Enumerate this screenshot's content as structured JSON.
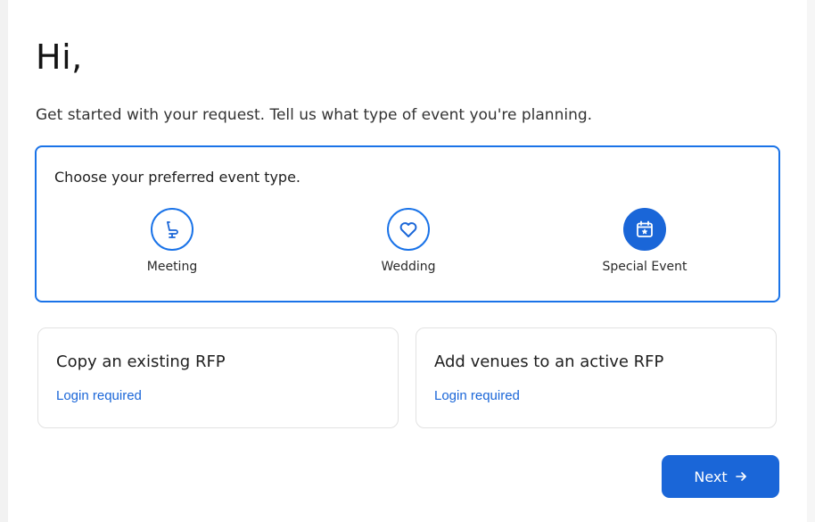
{
  "greeting": "Hi,",
  "intro": "Get started with your request. Tell us what type of event you're planning.",
  "event_type": {
    "prompt": "Choose your preferred event type.",
    "options": [
      {
        "label": "Meeting",
        "icon": "chair-icon",
        "selected": false
      },
      {
        "label": "Wedding",
        "icon": "heart-icon",
        "selected": false
      },
      {
        "label": "Special Event",
        "icon": "calendar-star-icon",
        "selected": true
      }
    ]
  },
  "cards": [
    {
      "title": "Copy an existing RFP",
      "link": "Login required"
    },
    {
      "title": "Add venues to an active RFP",
      "link": "Login required"
    }
  ],
  "next_button": {
    "label": "Next",
    "icon": "arrow-right-icon"
  },
  "colors": {
    "accent": "#1a66d8",
    "border": "#1a73e8",
    "card_border": "#e2e2e2"
  }
}
